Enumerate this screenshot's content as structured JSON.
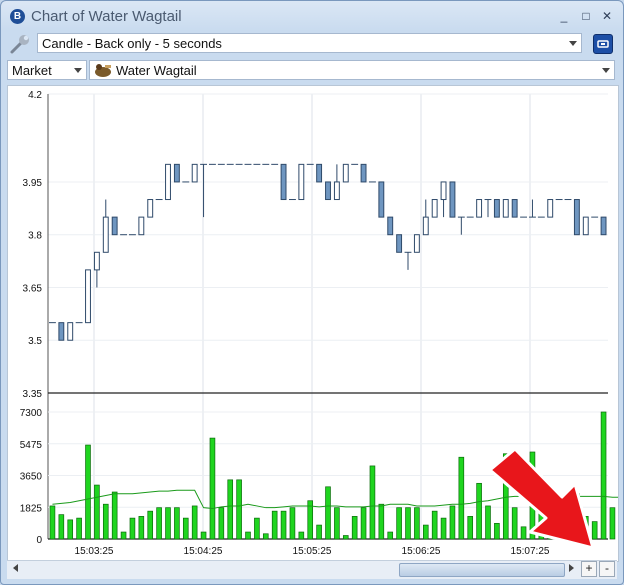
{
  "window": {
    "title": "Chart of Water Wagtail",
    "app_badge": "B"
  },
  "controls": {
    "minimize": "_",
    "maximize": "□",
    "close": "✕"
  },
  "toolbar": {
    "chart_type_value": "Candle - Back only - 5 seconds",
    "market_type_value": "Market",
    "selection_value": "Water Wagtail"
  },
  "icons": {
    "wrench": "wrench-icon",
    "config": "config-icon",
    "horse": "horse-silks-icon"
  },
  "colors": {
    "candle_down": "#6f96c0",
    "candle_up": "#ffffff",
    "candle_stroke": "#2f4a6a",
    "volume_bar": "#1fd51f",
    "volume_stroke": "#0a6a0a",
    "avg_line": "#1a9a1a",
    "arrow": "#e8161b"
  },
  "scroll": {
    "plus_label": "+",
    "minus_label": "-"
  },
  "chart_data": [
    {
      "type": "candlestick",
      "ylim": [
        3.35,
        4.2
      ],
      "y_ticks": [
        "4.2",
        "3.95",
        "3.8",
        "3.65",
        "3.5",
        "3.35"
      ],
      "x_ticks": [
        "15:03:25",
        "15:04:25",
        "15:05:25",
        "15:06:25",
        "15:07:25"
      ],
      "candles": [
        {
          "o": 3.55,
          "c": 3.55,
          "h": 3.55,
          "l": 3.55
        },
        {
          "o": 3.55,
          "c": 3.5,
          "h": 3.55,
          "l": 3.5
        },
        {
          "o": 3.5,
          "c": 3.55,
          "h": 3.55,
          "l": 3.5
        },
        {
          "o": 3.55,
          "c": 3.55,
          "h": 3.55,
          "l": 3.55
        },
        {
          "o": 3.55,
          "c": 3.7,
          "h": 3.7,
          "l": 3.55
        },
        {
          "o": 3.7,
          "c": 3.75,
          "h": 3.75,
          "l": 3.65
        },
        {
          "o": 3.75,
          "c": 3.85,
          "h": 3.9,
          "l": 3.75
        },
        {
          "o": 3.85,
          "c": 3.8,
          "h": 3.85,
          "l": 3.8
        },
        {
          "o": 3.8,
          "c": 3.8,
          "h": 3.8,
          "l": 3.8
        },
        {
          "o": 3.8,
          "c": 3.8,
          "h": 3.8,
          "l": 3.8
        },
        {
          "o": 3.8,
          "c": 3.85,
          "h": 3.85,
          "l": 3.8
        },
        {
          "o": 3.85,
          "c": 3.9,
          "h": 3.9,
          "l": 3.85
        },
        {
          "o": 3.9,
          "c": 3.9,
          "h": 3.9,
          "l": 3.9
        },
        {
          "o": 3.9,
          "c": 4.0,
          "h": 4.0,
          "l": 3.9
        },
        {
          "o": 4.0,
          "c": 3.95,
          "h": 4.0,
          "l": 3.95
        },
        {
          "o": 3.95,
          "c": 3.95,
          "h": 3.95,
          "l": 3.95
        },
        {
          "o": 3.95,
          "c": 4.0,
          "h": 4.0,
          "l": 3.95
        },
        {
          "o": 4.0,
          "c": 4.0,
          "h": 4.0,
          "l": 3.85
        },
        {
          "o": 4.0,
          "c": 4.0,
          "h": 4.0,
          "l": 4.0
        },
        {
          "o": 4.0,
          "c": 4.0,
          "h": 4.0,
          "l": 4.0
        },
        {
          "o": 4.0,
          "c": 4.0,
          "h": 4.0,
          "l": 4.0
        },
        {
          "o": 4.0,
          "c": 4.0,
          "h": 4.0,
          "l": 4.0
        },
        {
          "o": 4.0,
          "c": 4.0,
          "h": 4.0,
          "l": 4.0
        },
        {
          "o": 4.0,
          "c": 4.0,
          "h": 4.0,
          "l": 4.0
        },
        {
          "o": 4.0,
          "c": 4.0,
          "h": 4.0,
          "l": 4.0
        },
        {
          "o": 4.0,
          "c": 4.0,
          "h": 4.0,
          "l": 4.0
        },
        {
          "o": 4.0,
          "c": 3.9,
          "h": 4.0,
          "l": 3.9
        },
        {
          "o": 3.9,
          "c": 3.9,
          "h": 3.9,
          "l": 3.9
        },
        {
          "o": 3.9,
          "c": 4.0,
          "h": 4.0,
          "l": 3.9
        },
        {
          "o": 4.0,
          "c": 4.0,
          "h": 4.0,
          "l": 4.0
        },
        {
          "o": 4.0,
          "c": 3.95,
          "h": 4.0,
          "l": 3.95
        },
        {
          "o": 3.95,
          "c": 3.9,
          "h": 3.95,
          "l": 3.9
        },
        {
          "o": 3.9,
          "c": 3.95,
          "h": 4.0,
          "l": 3.9
        },
        {
          "o": 3.95,
          "c": 4.0,
          "h": 4.0,
          "l": 3.95
        },
        {
          "o": 4.0,
          "c": 4.0,
          "h": 4.0,
          "l": 4.0
        },
        {
          "o": 4.0,
          "c": 3.95,
          "h": 4.0,
          "l": 3.95
        },
        {
          "o": 3.95,
          "c": 3.95,
          "h": 3.95,
          "l": 3.95
        },
        {
          "o": 3.95,
          "c": 3.85,
          "h": 3.95,
          "l": 3.85
        },
        {
          "o": 3.85,
          "c": 3.8,
          "h": 3.85,
          "l": 3.8
        },
        {
          "o": 3.8,
          "c": 3.75,
          "h": 3.8,
          "l": 3.75
        },
        {
          "o": 3.75,
          "c": 3.75,
          "h": 3.75,
          "l": 3.7
        },
        {
          "o": 3.75,
          "c": 3.8,
          "h": 3.8,
          "l": 3.75
        },
        {
          "o": 3.8,
          "c": 3.85,
          "h": 3.9,
          "l": 3.8
        },
        {
          "o": 3.85,
          "c": 3.9,
          "h": 3.9,
          "l": 3.85
        },
        {
          "o": 3.9,
          "c": 3.95,
          "h": 3.95,
          "l": 3.85
        },
        {
          "o": 3.95,
          "c": 3.85,
          "h": 3.95,
          "l": 3.85
        },
        {
          "o": 3.85,
          "c": 3.85,
          "h": 3.85,
          "l": 3.8
        },
        {
          "o": 3.85,
          "c": 3.85,
          "h": 3.85,
          "l": 3.85
        },
        {
          "o": 3.85,
          "c": 3.9,
          "h": 3.9,
          "l": 3.85
        },
        {
          "o": 3.9,
          "c": 3.9,
          "h": 3.9,
          "l": 3.85
        },
        {
          "o": 3.9,
          "c": 3.85,
          "h": 3.9,
          "l": 3.85
        },
        {
          "o": 3.85,
          "c": 3.9,
          "h": 3.9,
          "l": 3.85
        },
        {
          "o": 3.9,
          "c": 3.85,
          "h": 3.9,
          "l": 3.85
        },
        {
          "o": 3.85,
          "c": 3.85,
          "h": 3.85,
          "l": 3.85
        },
        {
          "o": 3.85,
          "c": 3.85,
          "h": 3.9,
          "l": 3.85
        },
        {
          "o": 3.85,
          "c": 3.85,
          "h": 3.85,
          "l": 3.85
        },
        {
          "o": 3.85,
          "c": 3.9,
          "h": 3.9,
          "l": 3.85
        },
        {
          "o": 3.9,
          "c": 3.9,
          "h": 3.9,
          "l": 3.9
        },
        {
          "o": 3.9,
          "c": 3.9,
          "h": 3.9,
          "l": 3.9
        },
        {
          "o": 3.9,
          "c": 3.8,
          "h": 3.9,
          "l": 3.8
        },
        {
          "o": 3.8,
          "c": 3.85,
          "h": 3.85,
          "l": 3.8
        },
        {
          "o": 3.85,
          "c": 3.85,
          "h": 3.85,
          "l": 3.85
        },
        {
          "o": 3.85,
          "c": 3.8,
          "h": 3.85,
          "l": 3.8
        }
      ]
    },
    {
      "type": "bar",
      "ylim": [
        0,
        7300
      ],
      "y_ticks": [
        "7300",
        "5475",
        "3650",
        "1825",
        "0"
      ],
      "volumes": [
        1900,
        1400,
        1100,
        1200,
        5400,
        3100,
        2000,
        2700,
        400,
        1200,
        1300,
        1600,
        1800,
        1800,
        1800,
        1200,
        1900,
        400,
        5800,
        1800,
        3400,
        3400,
        400,
        1200,
        300,
        1600,
        1600,
        1800,
        400,
        2200,
        800,
        3000,
        1800,
        200,
        1300,
        1800,
        4200,
        2000,
        400,
        1800,
        1800,
        1800,
        800,
        1600,
        1200,
        1900,
        4700,
        1300,
        3200,
        1900,
        900,
        4900,
        1800,
        700,
        5000,
        3000,
        1600,
        1800,
        700,
        2600,
        1300,
        1000,
        7300,
        1800,
        1700,
        1500,
        700,
        1600,
        2900,
        2200,
        1800
      ],
      "average": [
        2000,
        2050,
        2100,
        2200,
        2300,
        2400,
        2500,
        2600,
        2600,
        2600,
        2650,
        2700,
        2750,
        2750,
        2800,
        2800,
        2800,
        1800,
        1750,
        1850,
        1900,
        1900,
        2000,
        1900,
        1800,
        1800,
        1850,
        1900,
        1900,
        1900,
        1850,
        1900,
        1900,
        1850,
        1850,
        1850,
        1900,
        1900,
        2000,
        2000,
        2000,
        1900,
        1900,
        1900,
        1950,
        2000,
        2000,
        2050,
        2150,
        2200,
        2300,
        2400,
        2450,
        2450,
        2450,
        2450,
        2450,
        2450,
        2450,
        2450,
        2450,
        2450,
        2450,
        2400,
        2400,
        2350,
        2350,
        2350,
        2350,
        2300,
        2300
      ]
    }
  ]
}
